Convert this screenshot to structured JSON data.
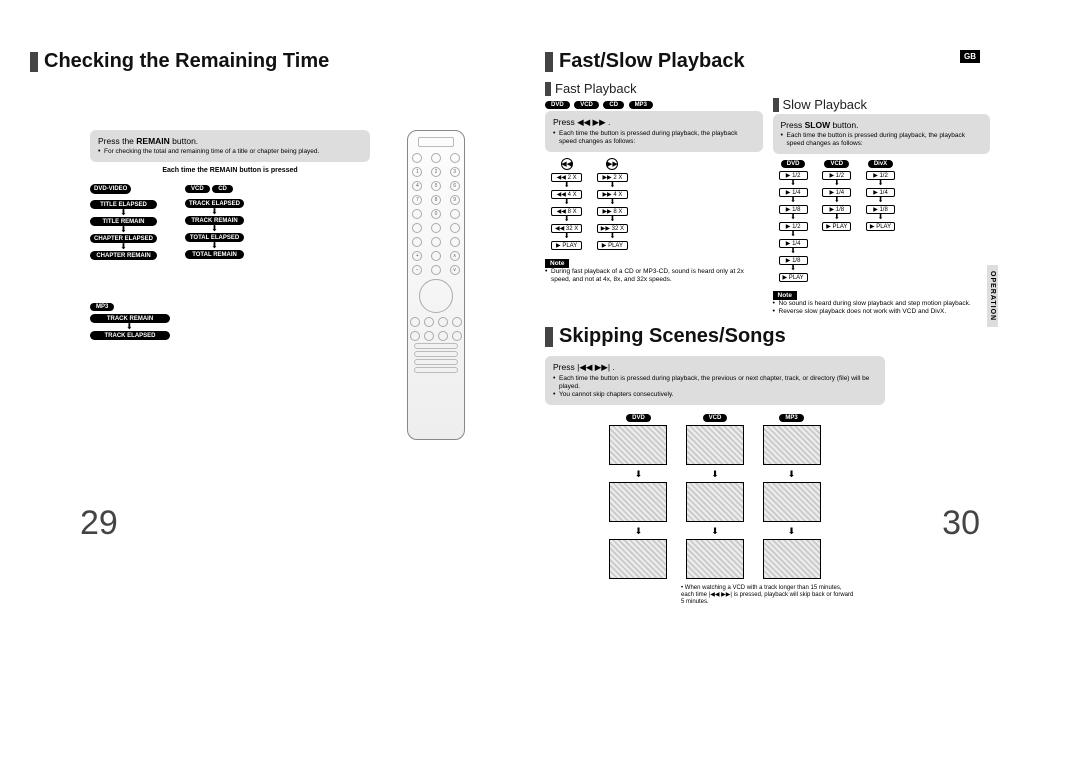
{
  "badge_gb": "GB",
  "operation_tab": "OPERATION",
  "page_left_num": "29",
  "page_right_num": "30",
  "left": {
    "title": "Checking the Remaining Time",
    "press_prefix": "Press the ",
    "press_bold": "REMAIN",
    "press_suffix": " button.",
    "bullet": "For checking the total and remaining time of a title or chapter being played.",
    "caption": "Each time the REMAIN button is pressed",
    "dvd_video_label": "DVD-VIDEO",
    "vcd_label": "VCD",
    "cd_label": "CD",
    "col1": [
      "TITLE ELAPSED",
      "TITLE REMAIN",
      "CHAPTER ELAPSED",
      "CHAPTER REMAIN"
    ],
    "col2": [
      "TRACK ELAPSED",
      "TRACK REMAIN",
      "TOTAL ELAPSED",
      "TOTAL REMAIN"
    ],
    "mp3_label": "MP3",
    "col3": [
      "TRACK REMAIN",
      "TRACK ELAPSED"
    ]
  },
  "right": {
    "title1": "Fast/Slow Playback",
    "fast": {
      "subtitle": "Fast Playback",
      "formats": [
        "DVD",
        "VCD",
        "CD",
        "MP3"
      ],
      "press_label": "Press",
      "press_icons": "◀◀ ▶▶ .",
      "bullet": "Each time the button is pressed during playback, the playback speed changes as follows:",
      "icon_rew": "◀◀",
      "icon_ff": "▶▶",
      "steps_rew": [
        "◀◀ 2 X",
        "◀◀ 4 X",
        "◀◀ 8 X",
        "◀◀ 32 X",
        "▶ PLAY"
      ],
      "steps_ff": [
        "▶▶ 2 X",
        "▶▶ 4 X",
        "▶▶ 8 X",
        "▶▶ 32 X",
        "▶ PLAY"
      ],
      "note_label": "Note",
      "note": "During fast playback of a CD or MP3-CD, sound is heard only at 2x speed, and not at 4x, 8x, and 32x speeds."
    },
    "slow": {
      "subtitle": "Slow Playback",
      "press_prefix": "Press ",
      "press_bold": "SLOW",
      "press_suffix": " button.",
      "bullet": "Each time the button is pressed during playback, the playback speed changes as follows:",
      "cols": [
        {
          "label": "DVD",
          "steps": [
            "▶ 1/2",
            "▶ 1/4",
            "▶ 1/8",
            "▶ 1/2",
            "▶ 1/4",
            "▶ 1/8",
            "▶ PLAY"
          ]
        },
        {
          "label": "VCD",
          "steps": [
            "▶ 1/2",
            "▶ 1/4",
            "▶ 1/8",
            "▶ PLAY"
          ]
        },
        {
          "label": "DivX",
          "steps": [
            "▶ 1/2",
            "▶ 1/4",
            "▶ 1/8",
            "▶ PLAY"
          ]
        }
      ],
      "note_label": "Note",
      "note1": "No sound is heard during slow playback and step motion playback.",
      "note2": "Reverse slow playback does not work with VCD and DivX."
    },
    "title2": "Skipping Scenes/Songs",
    "skip": {
      "press_label": "Press",
      "press_icons": "|◀◀ ▶▶| .",
      "bullet1": "Each time the button is pressed during playback, the previous or next chapter, track, or directory (file) will be played.",
      "bullet2": "You cannot skip chapters consecutively.",
      "cols": [
        "DVD",
        "VCD",
        "MP3"
      ],
      "footnote_prefix": "When watching a VCD with a track longer than 15 minutes, each time ",
      "footnote_icons": "|◀◀ ▶▶|",
      "footnote_suffix": " is pressed, playback will skip back or forward 5 minutes."
    }
  }
}
